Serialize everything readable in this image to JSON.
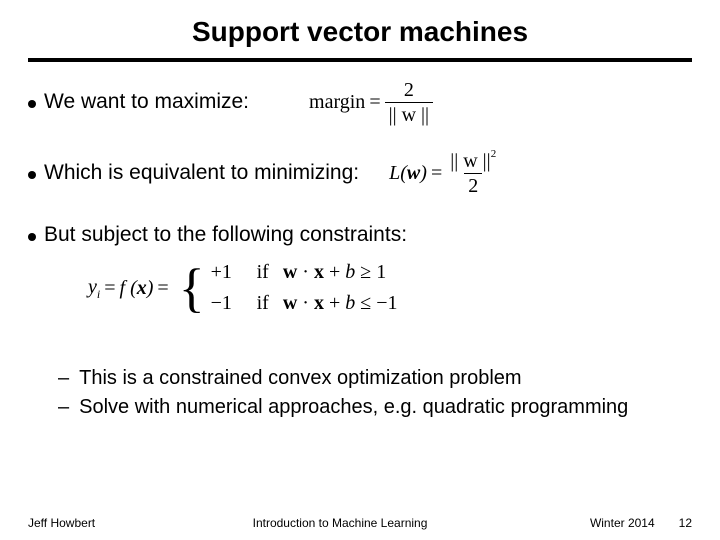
{
  "title": "Support vector machines",
  "bullets": {
    "b1": "We want to maximize:",
    "b2": "Which is equivalent to minimizing:",
    "b3": "But subject to the following constraints:"
  },
  "equations": {
    "margin_lhs": "margin",
    "eq": "=",
    "two": "2",
    "norm_w": "|| w ||",
    "L_lhs": "L(w)",
    "norm_w_sq_num": "|| w ||",
    "sq": "2",
    "den2": "2",
    "yi": "yᵢ",
    "fx": "f (x)",
    "plus1": "+1",
    "minus1": "−1",
    "if": "if",
    "cond1": "w · x + b ≥ 1",
    "cond2": "w · x + b ≤ −1"
  },
  "subbullets": {
    "s1": "This is a constrained convex optimization problem",
    "s2": "Solve with numerical approaches, e.g. quadratic programming"
  },
  "footer": {
    "left": "Jeff Howbert",
    "center": "Introduction to Machine Learning",
    "term": "Winter 2014",
    "page": "12"
  }
}
